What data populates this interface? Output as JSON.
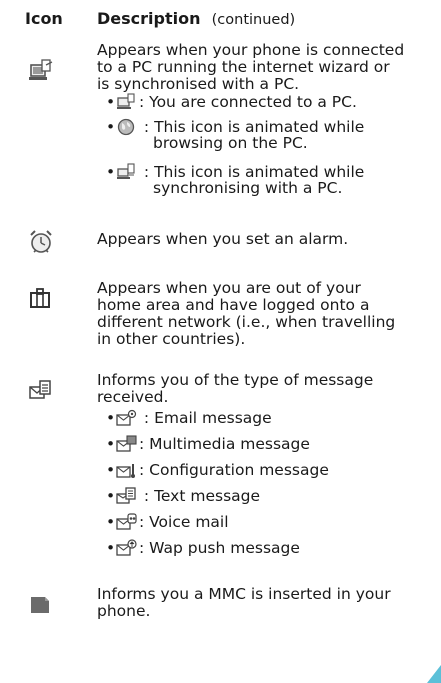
{
  "header": {
    "icon_label": "Icon",
    "description_label": "Description",
    "continued": "(continued)"
  },
  "entries": [
    {
      "icon": "pc-connection-icon",
      "lines": [
        "Appears when your phone is connected",
        "to a PC running the internet wizard or",
        "is synchronised with a PC."
      ],
      "bullets": [
        {
          "icon": "pc-connected-icon",
          "lines": [
            "You are connected to a PC."
          ]
        },
        {
          "icon": "globe-browsing-icon",
          "lines": [
            "This icon is animated while",
            "browsing on the PC."
          ]
        },
        {
          "icon": "pc-sync-icon",
          "lines": [
            "This icon is animated while",
            "synchronising with a PC."
          ]
        }
      ]
    },
    {
      "icon": "alarm-clock-icon",
      "lines": [
        "Appears when you set an alarm."
      ]
    },
    {
      "icon": "roaming-suitcase-icon",
      "lines": [
        "Appears when you are out of your",
        "home area and have logged onto a",
        "different network (i.e., when travelling",
        "in other countries)."
      ]
    },
    {
      "icon": "message-received-icon",
      "lines": [
        "Informs you of the type of message",
        "received."
      ],
      "bullets": [
        {
          "icon": "email-message-icon",
          "text": "Email message"
        },
        {
          "icon": "multimedia-message-icon",
          "text": "Multimedia message"
        },
        {
          "icon": "configuration-message-icon",
          "text": "Configuration message"
        },
        {
          "icon": "text-message-icon",
          "text": "Text message"
        },
        {
          "icon": "voice-mail-icon",
          "text": "Voice mail"
        },
        {
          "icon": "wap-push-message-icon",
          "text": "Wap push message"
        }
      ]
    },
    {
      "icon": "memory-card-icon",
      "lines": [
        "Informs you a MMC is inserted in your",
        "phone."
      ]
    }
  ],
  "colors": {
    "accent": "#5bc0d8",
    "icon_gray": "#6b6b6b"
  }
}
